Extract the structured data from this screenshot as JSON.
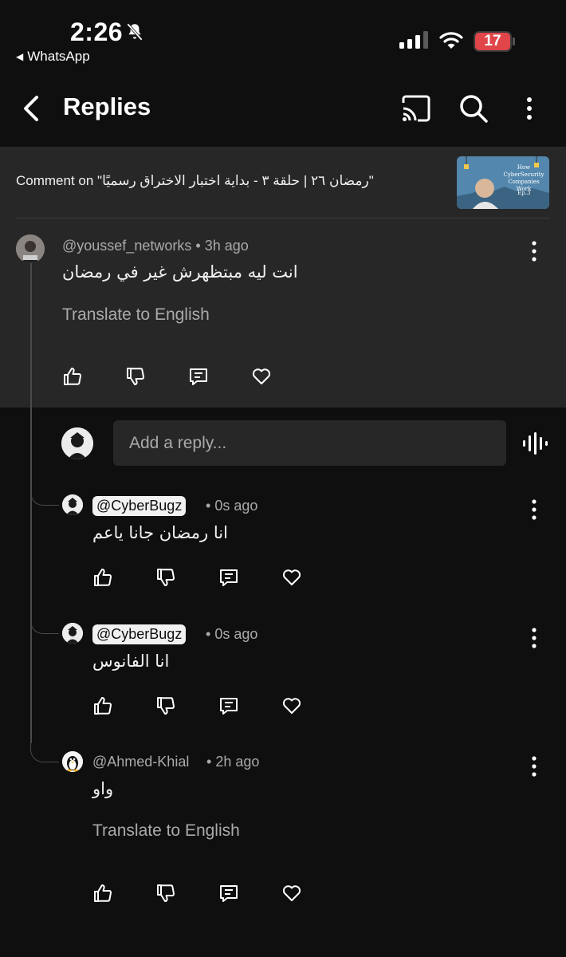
{
  "status_bar": {
    "time": "2:26",
    "back_app": "WhatsApp",
    "battery": "17"
  },
  "header": {
    "title": "Replies"
  },
  "video": {
    "comment_on": "Comment on \"رمضان ٢٦ | حلقة ٣ - بداية اختبار الاختراق رسميًا\"",
    "thumbnail_text": "How CyberSecurity Companies Work",
    "thumbnail_ep": "Ep.3"
  },
  "parent_comment": {
    "author": "@youssef_networks",
    "separator": "•",
    "time": "3h ago",
    "text": "انت ليه مبتظهرش غير في رمضان",
    "translate": "Translate to English"
  },
  "reply_box": {
    "placeholder": "Add a reply..."
  },
  "replies": [
    {
      "author": "@CyberBugz",
      "separator": "•",
      "time": "0s ago",
      "text": "انا رمضان جانا ياعم",
      "highlight": true
    },
    {
      "author": "@CyberBugz",
      "separator": "•",
      "time": "0s ago",
      "text": "انا الفانوس",
      "highlight": true
    },
    {
      "author": "@Ahmed-Khial",
      "separator": "•",
      "time": "2h ago",
      "text": "واو",
      "translate": "Translate to English",
      "highlight": false
    }
  ],
  "colors": {
    "background": "#0f0f0f",
    "surface": "#272727",
    "text_primary": "#f1f1f1",
    "text_secondary": "#aaaaaa",
    "battery_red": "#e0454a"
  },
  "icons": [
    "bell-off-icon",
    "signal-icon",
    "wifi-icon",
    "back-arrow-icon",
    "cast-icon",
    "search-icon",
    "more-vert-icon",
    "like-icon",
    "dislike-icon",
    "reply-icon",
    "heart-icon",
    "voice-search-icon"
  ]
}
